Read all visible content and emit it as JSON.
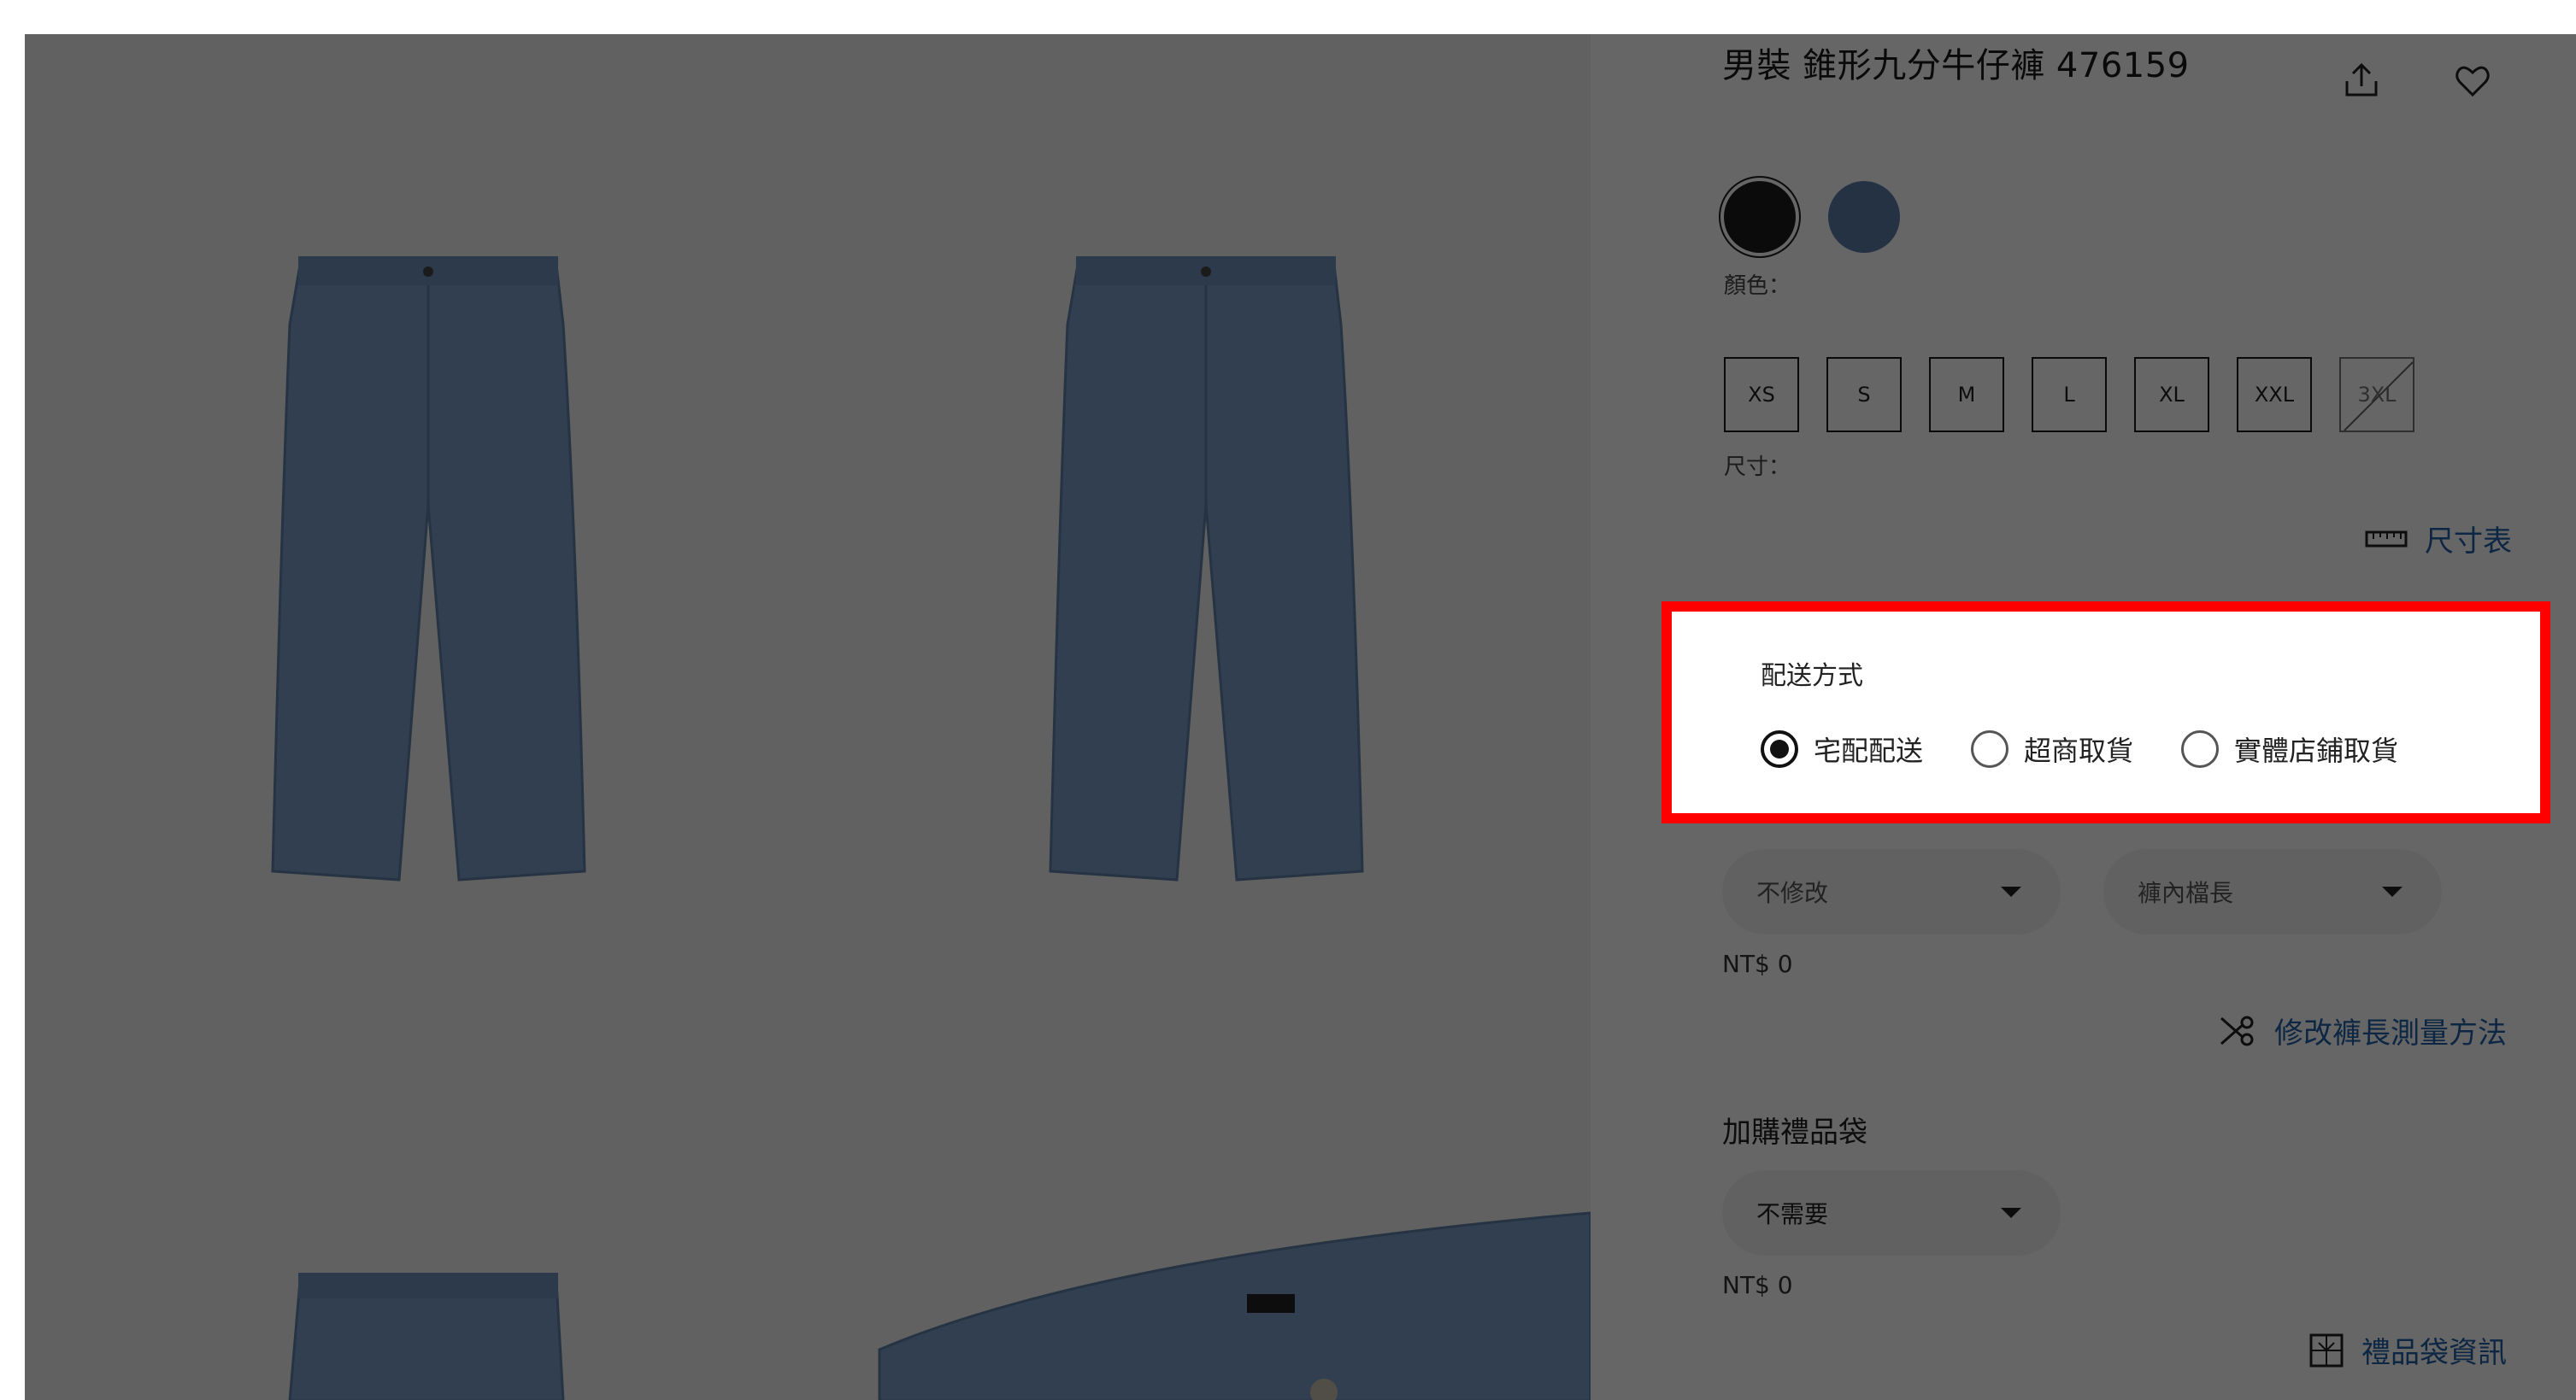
{
  "product": {
    "title": "男裝 錐形九分牛仔褲 476159"
  },
  "colors": {
    "label": "顏色：",
    "swatches": [
      {
        "name": "black",
        "hex": "#1d1d1f"
      },
      {
        "name": "blue",
        "hex": "#5a7eaa"
      }
    ]
  },
  "sizes": {
    "label": "尺寸：",
    "options": [
      "XS",
      "S",
      "M",
      "L",
      "XL",
      "XXL",
      "3XL"
    ],
    "unavailable": [
      "3XL"
    ]
  },
  "size_chart_link": "尺寸表",
  "delivery": {
    "title": "配送方式",
    "options": [
      {
        "label": "宅配配送",
        "selected": true
      },
      {
        "label": "超商取貨",
        "selected": false
      },
      {
        "label": "實體店鋪取貨",
        "selected": false
      }
    ]
  },
  "alteration": {
    "select_1": "不修改",
    "select_2": "褲內檔長",
    "price": "NT$ 0",
    "guide_link": "修改褲長測量方法"
  },
  "gift_bag": {
    "title": "加購禮品袋",
    "select": "不需要",
    "price": "NT$ 0",
    "info_link": "禮品袋資訊"
  },
  "icons": {
    "share": "share-icon",
    "wishlist": "heart-icon",
    "ruler": "ruler-icon",
    "scissors": "scissors-icon",
    "gift": "gift-icon",
    "caret": "caret-down-icon"
  },
  "theme": {
    "link_color": "#1f5fa8",
    "highlight_color": "#ff0000",
    "denim_color": "#7b9dc7"
  }
}
